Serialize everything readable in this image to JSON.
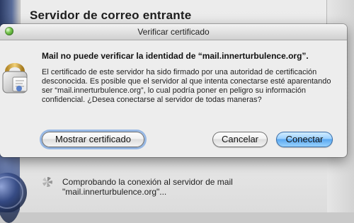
{
  "background": {
    "section_title": "Servidor de correo entrante",
    "progress": {
      "line1": "Comprobando la conexión al servidor de mail",
      "line2": "\"mail.innerturbulence.org\"..."
    }
  },
  "dialog": {
    "title": "Verificar certificado",
    "headline": "Mail no puede verificar la identidad de “mail.innerturbulence.org”.",
    "message": "El certificado de este servidor ha sido firmado por una autoridad de certificación desconocida. Es posible que el servidor al que intenta conectarse esté aparentando ser “mail.innerturbulence.org”, lo cual podría poner en peligro su información confidencial. ¿Desea conectarse al servidor de todas maneras?",
    "buttons": {
      "show_certificate": "Mostrar certificado",
      "cancel": "Cancelar",
      "connect": "Conectar"
    }
  },
  "icons": {
    "window_control": "green-window-button-icon",
    "warning": "lock-icon",
    "spinner": "spinner-icon"
  },
  "colors": {
    "primary_button": "#5aa8f0",
    "focus_ring": "#508cdc",
    "dialog_bg": "#ededed"
  }
}
